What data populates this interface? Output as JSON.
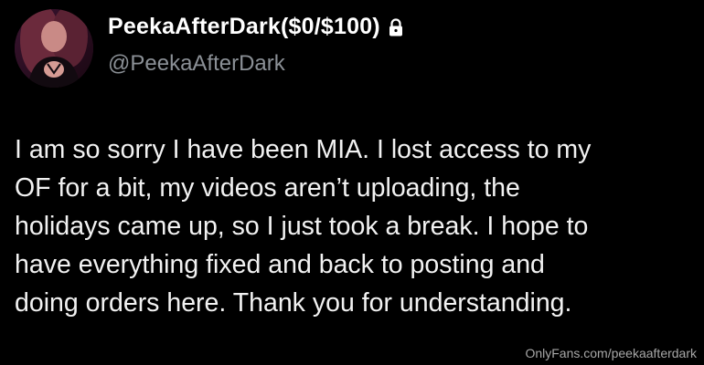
{
  "tweet": {
    "display_name": "PeekaAfterDark($0/$100)",
    "handle": "@PeekaAfterDark",
    "lock_icon": "lock-icon",
    "avatar_icon": "profile-avatar",
    "text_lines": [
      "I am so sorry I have been MIA. I lost access to my",
      "OF for a bit, my videos aren’t uploading, the",
      "holidays came up, so I just took a break. I hope to",
      "have everything fixed and back to posting and",
      "doing orders here. Thank you for understanding."
    ]
  },
  "watermark": {
    "text": "OnlyFans.com/peekaafterdark"
  },
  "colors": {
    "background": "#000000",
    "text": "#f2f2f2",
    "handle": "#8b9096",
    "watermark": "#c4c4c4"
  }
}
